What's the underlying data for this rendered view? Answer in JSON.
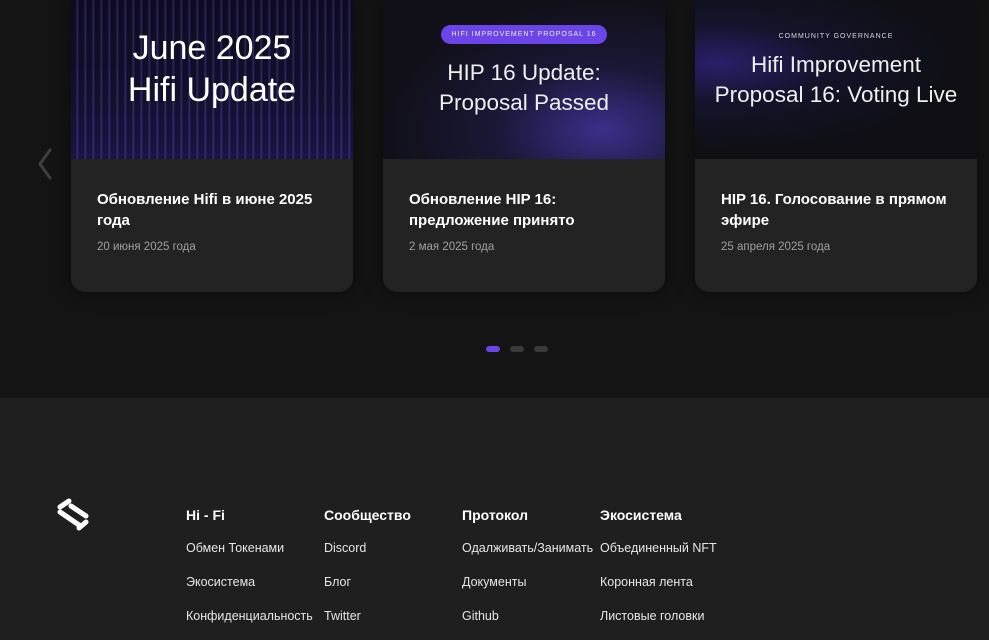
{
  "blog": {
    "cards": [
      {
        "image_headline_line1": "June 2025",
        "image_headline_line2": "Hifi Update",
        "title": "Обновление Hifi в июне 2025 года",
        "date": "20 июня 2025 года"
      },
      {
        "image_pill": "HIFI IMPROVEMENT PROPOSAL 16",
        "image_headline_line1": "HIP 16 Update:",
        "image_headline_line2": "Proposal Passed",
        "title": "Обновление HIP 16: предложение принято",
        "date": "2 мая 2025 года"
      },
      {
        "image_eyebrow": "COMMUNITY GOVERNANCE",
        "image_headline_line1": "Hifi Improvement",
        "image_headline_line2": "Proposal 16: Voting Live",
        "title": "HIP 16. Голосование в прямом эфире",
        "date": "25 апреля 2025 года"
      }
    ],
    "pagination": {
      "count": 3,
      "active_index": 0
    },
    "prev_icon": "chevron-left-icon",
    "accent_color": "#6b45e8"
  },
  "footer": {
    "logo_icon": "hifi-logo-icon",
    "columns": [
      {
        "title": "Hi - Fi",
        "links": [
          "Обмен Токенами",
          "Экосистема",
          "Конфиденциальность"
        ]
      },
      {
        "title": "Сообщество",
        "links": [
          "Discord",
          "Блог",
          "Twitter"
        ]
      },
      {
        "title": "Протокол",
        "links": [
          "Одалживать/Занимать",
          "Документы",
          "Github"
        ]
      },
      {
        "title": "Экосистема",
        "links": [
          "Объединенный NFT",
          "Коронная лента",
          "Листовые головки"
        ]
      }
    ]
  }
}
